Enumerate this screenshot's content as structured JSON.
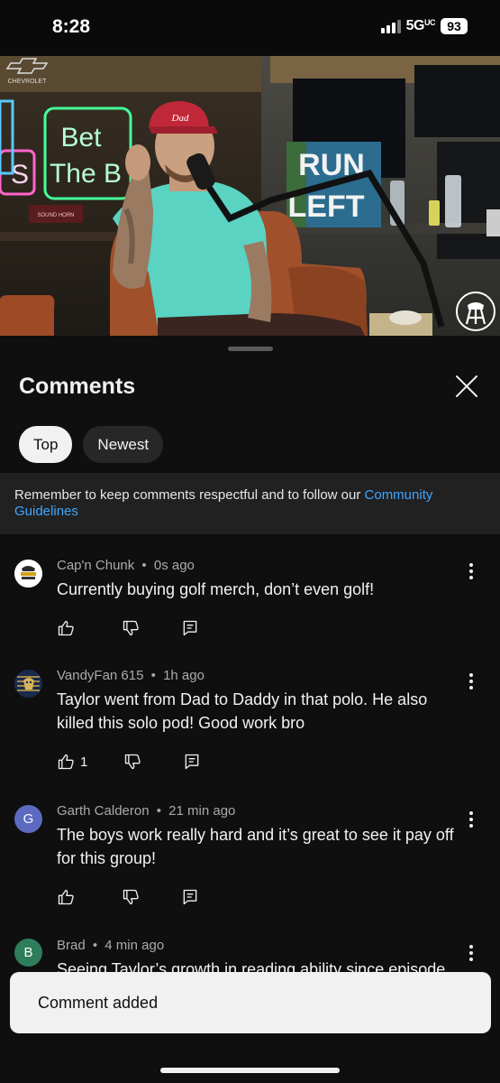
{
  "status_bar": {
    "time": "8:28",
    "network": "5G",
    "network_suffix": "UC",
    "battery": "93"
  },
  "video": {
    "brand_logo": "CHEVROLET",
    "neon_sign": [
      "Bet",
      "The B"
    ],
    "neon_left_letter": "S",
    "sign_right": [
      "RUN",
      "LEFT"
    ],
    "sign_small": "SOUND HORN",
    "cap_text": "Dad",
    "watermark_icon": "barstool-logo-icon"
  },
  "comments_sheet": {
    "title": "Comments",
    "close_icon": "close-icon",
    "chips": [
      {
        "label": "Top",
        "active": true
      },
      {
        "label": "Newest",
        "active": false
      }
    ],
    "notice": {
      "text": "Remember to keep comments respectful and to follow our ",
      "link": "Community Guidelines"
    },
    "comments": [
      {
        "author": "Cap'n Chunk",
        "time": "0s ago",
        "text": "Currently buying golf merch, don’t even golf!",
        "likes": "",
        "avatar_text": "CAP'N CHUNK"
      },
      {
        "author": "VandyFan 615",
        "time": "1h ago",
        "text": "Taylor went from Dad to Daddy in that polo. He also killed this solo pod! Good work bro",
        "likes": "1",
        "avatar_text": ""
      },
      {
        "author": "Garth Calderon",
        "time": "21 min ago",
        "text": "The boys work really hard and it’s great to see it pay off for this group!",
        "likes": "",
        "avatar_text": "G"
      },
      {
        "author": "Brad",
        "time": "4 min ago",
        "text": "Seeing Taylor’s growth in reading ability since episode",
        "likes": "",
        "avatar_text": "B"
      }
    ],
    "meta_separator": "•",
    "colors": {
      "avatar_g": "#5c6bc0",
      "avatar_b": "#2e7d5b",
      "link": "#3ea6ff"
    }
  },
  "toast": {
    "text": "Comment added"
  }
}
